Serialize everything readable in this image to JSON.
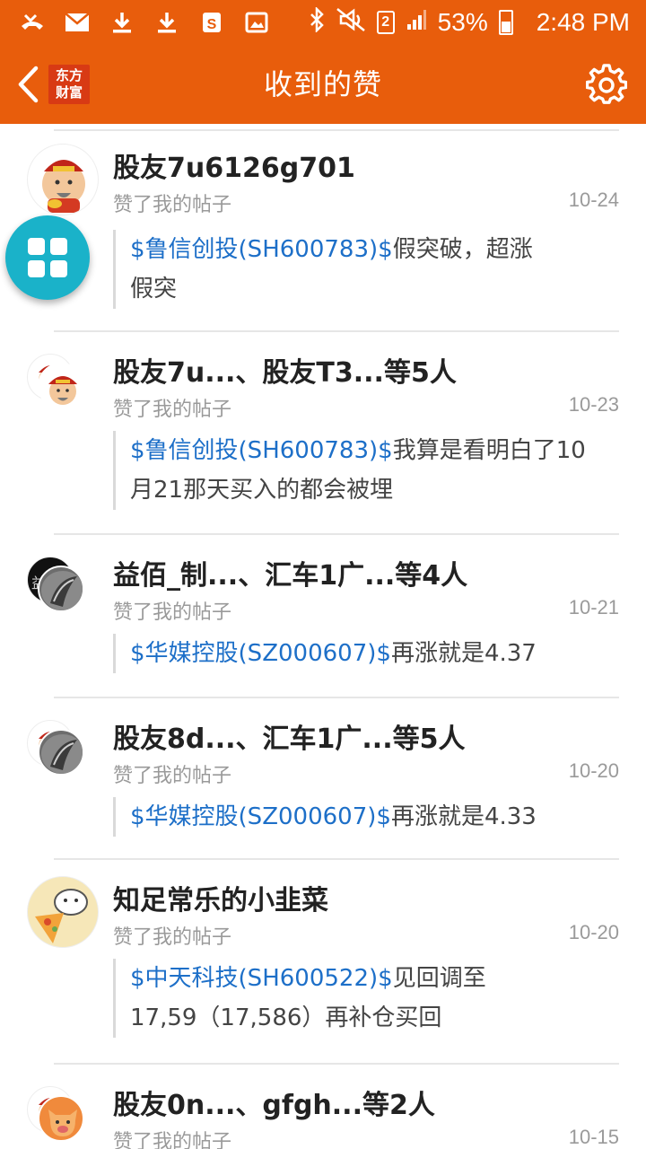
{
  "status_bar": {
    "battery": "53%",
    "time": "2:48 PM",
    "sim": "2",
    "icons": [
      "missed-call-icon",
      "mail-icon",
      "download-icon",
      "download-icon",
      "app-s-icon",
      "image-icon",
      "bluetooth-icon",
      "mute-icon",
      "sim-icon",
      "signal-icon",
      "battery-icon"
    ]
  },
  "app_bar": {
    "title": "收到的赞",
    "logo_line1": "东方",
    "logo_line2": "财富"
  },
  "items": [
    {
      "name": "股友7u6126g701",
      "action": "赞了我的帖子",
      "date": "10-24",
      "tag": "$鲁信创投(SH600783)$",
      "text_line1": "假突破，超涨",
      "text_line2": "假突"
    },
    {
      "name": "股友7u...、股友T3...等5人",
      "action": "赞了我的帖子",
      "date": "10-23",
      "tag": "$鲁信创投(SH600783)$",
      "text_line1": "我算是看明白了10",
      "text_line2": "月21那天买入的都会被埋"
    },
    {
      "name": "益佰_制...、汇车1广...等4人",
      "action": "赞了我的帖子",
      "date": "10-21",
      "tag": "$华媒控股(SZ000607)$",
      "text_line1": "再涨就是4.37"
    },
    {
      "name": "股友8d...、汇车1广...等5人",
      "action": "赞了我的帖子",
      "date": "10-20",
      "tag": "$华媒控股(SZ000607)$",
      "text_line1": "再涨就是4.33"
    },
    {
      "name": "知足常乐的小韭菜",
      "action": "赞了我的帖子",
      "date": "10-20",
      "tag": "$中天科技(SH600522)$",
      "text_line1": "见回调至",
      "text_line2": "17,59（17,586）再补仓买回"
    },
    {
      "name": "股友0n...、gfgh...等2人",
      "action": "赞了我的帖子",
      "date": "10-15"
    }
  ],
  "colors": {
    "brand": "#e85d0c",
    "link": "#1d6fc8",
    "fab": "#1ab2c9"
  }
}
